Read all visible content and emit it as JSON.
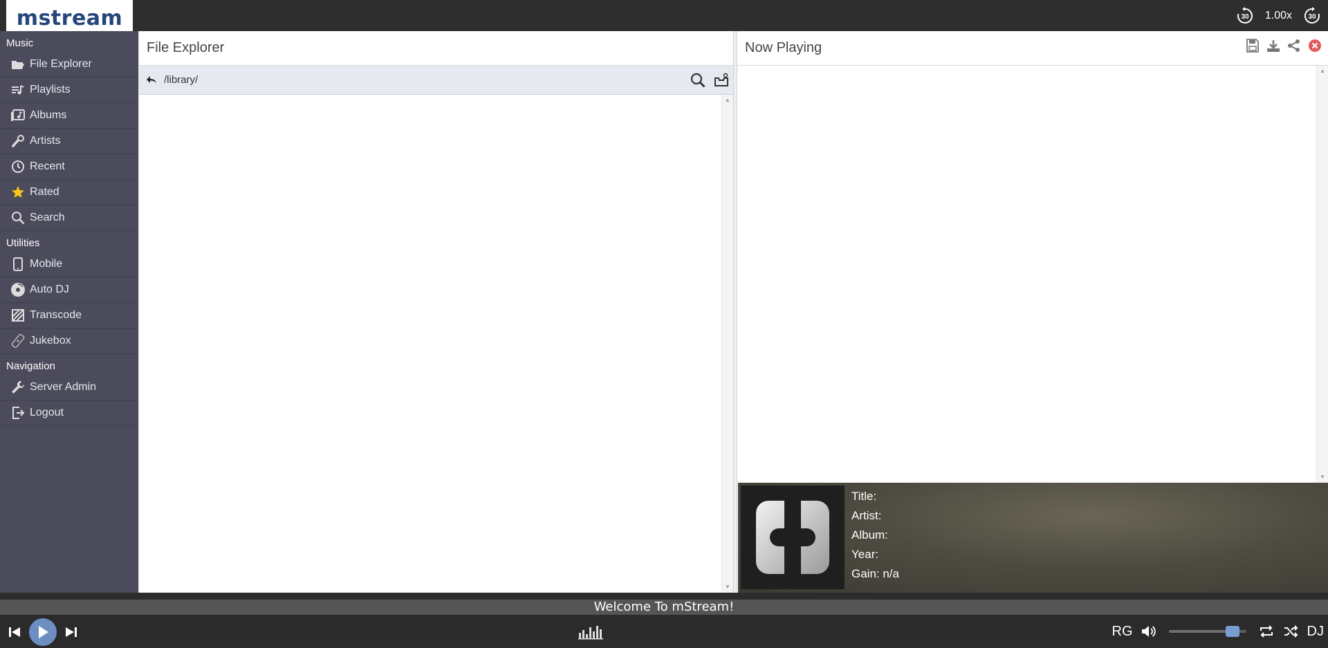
{
  "app": {
    "logo": "mstream"
  },
  "top": {
    "speed": "1.00x",
    "rewind_label": "30",
    "forward_label": "30"
  },
  "sidebar": {
    "sections": [
      {
        "title": "Music",
        "items": [
          {
            "label": "File Explorer",
            "icon": "folder-open-icon"
          },
          {
            "label": "Playlists",
            "icon": "playlist-icon"
          },
          {
            "label": "Albums",
            "icon": "album-icon"
          },
          {
            "label": "Artists",
            "icon": "microphone-icon"
          },
          {
            "label": "Recent",
            "icon": "clock-icon"
          },
          {
            "label": "Rated",
            "icon": "star-icon"
          },
          {
            "label": "Search",
            "icon": "search-icon"
          }
        ]
      },
      {
        "title": "Utilities",
        "items": [
          {
            "label": "Mobile",
            "icon": "mobile-icon"
          },
          {
            "label": "Auto DJ",
            "icon": "disc-icon"
          },
          {
            "label": "Transcode",
            "icon": "transcode-icon"
          },
          {
            "label": "Jukebox",
            "icon": "remote-icon"
          }
        ]
      },
      {
        "title": "Navigation",
        "items": [
          {
            "label": "Server Admin",
            "icon": "wrench-icon"
          },
          {
            "label": "Logout",
            "icon": "logout-icon"
          }
        ]
      }
    ]
  },
  "file_explorer": {
    "title": "File Explorer",
    "path": "/library/"
  },
  "now_playing": {
    "title": "Now Playing"
  },
  "metadata": {
    "title": "Title:",
    "artist": "Artist:",
    "album": "Album:",
    "year": "Year:",
    "gain": "Gain: n/a"
  },
  "status": {
    "message": "Welcome To mStream!"
  },
  "player": {
    "rg": "RG",
    "dj": "DJ",
    "volume": 0.9
  },
  "colors": {
    "accent": "#6d8ec0",
    "sidebar": "#4b4b5c",
    "topbar": "#2e2e2e",
    "star": "#f5c518",
    "close": "#e05a5a"
  }
}
